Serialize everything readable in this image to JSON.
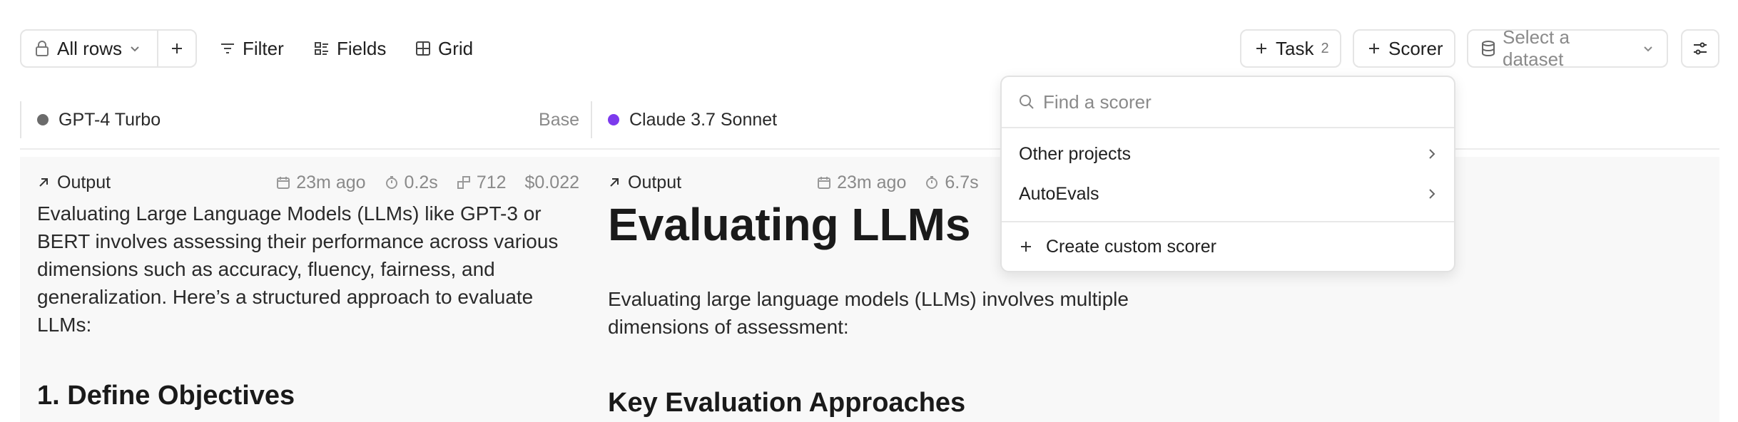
{
  "toolbar": {
    "rows_label": "All rows",
    "filter_label": "Filter",
    "fields_label": "Fields",
    "grid_label": "Grid",
    "task_label": "Task",
    "task_count": "2",
    "scorer_label": "Scorer",
    "dataset_placeholder": "Select a dataset"
  },
  "columns": [
    {
      "model": "GPT-4 Turbo",
      "tag": "Base",
      "dot_color": "#6b6b6b"
    },
    {
      "model": "Claude 3.7 Sonnet",
      "tag": "",
      "dot_color": "#7c3aed"
    }
  ],
  "outputs": [
    {
      "label": "Output",
      "time_ago": "23m ago",
      "duration": "0.2s",
      "tokens": "712",
      "cost": "$0.022",
      "text_lines": [
        "Evaluating Large Language Models (LLMs) like GPT-3 or",
        "BERT involves assessing their performance across various",
        "dimensions such as accuracy, fluency, fairness, and",
        "generalization. Here’s a structured approach to evaluate",
        "LLMs:"
      ],
      "heading": "1. Define Objectives"
    },
    {
      "label": "Output",
      "time_ago": "23m ago",
      "duration": "6.7s",
      "title": "Evaluating LLMs",
      "text_lines": [
        "Evaluating large language models (LLMs) involves multiple",
        "dimensions of assessment:"
      ],
      "heading": "Key Evaluation Approaches"
    }
  ],
  "scorer_menu": {
    "search_placeholder": "Find a scorer",
    "items": [
      "Other projects",
      "AutoEvals"
    ],
    "create_label": "Create custom scorer"
  }
}
